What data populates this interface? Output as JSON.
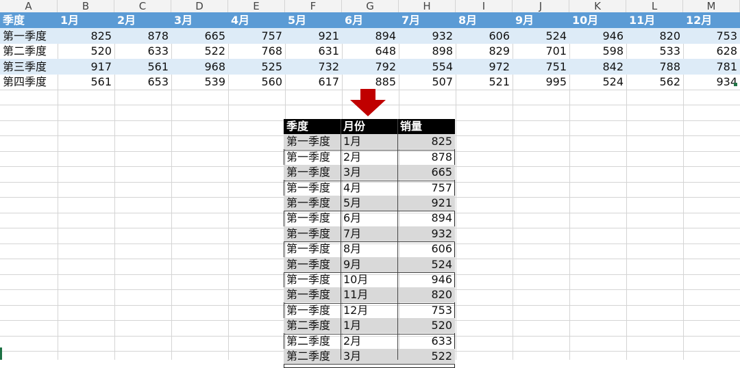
{
  "columns": [
    "A",
    "B",
    "C",
    "D",
    "E",
    "F",
    "G",
    "H",
    "I",
    "J",
    "K",
    "L",
    "M"
  ],
  "source_table": {
    "header": [
      "季度",
      "1月",
      "2月",
      "3月",
      "4月",
      "5月",
      "6月",
      "7月",
      "8月",
      "9月",
      "10月",
      "11月",
      "12月"
    ],
    "rows": [
      {
        "label": "第一季度",
        "values": [
          "825",
          "878",
          "665",
          "757",
          "921",
          "894",
          "932",
          "606",
          "524",
          "946",
          "820",
          "753"
        ]
      },
      {
        "label": "第二季度",
        "values": [
          "520",
          "633",
          "522",
          "768",
          "631",
          "648",
          "898",
          "829",
          "701",
          "598",
          "533",
          "628"
        ]
      },
      {
        "label": "第三季度",
        "values": [
          "917",
          "561",
          "968",
          "525",
          "732",
          "792",
          "554",
          "972",
          "751",
          "842",
          "788",
          "781"
        ]
      },
      {
        "label": "第四季度",
        "values": [
          "561",
          "653",
          "539",
          "560",
          "617",
          "885",
          "507",
          "521",
          "995",
          "524",
          "562",
          "934"
        ]
      }
    ]
  },
  "result_table": {
    "header": [
      "季度",
      "月份",
      "销量"
    ],
    "rows": [
      [
        "第一季度",
        "1月",
        "825"
      ],
      [
        "第一季度",
        "2月",
        "878"
      ],
      [
        "第一季度",
        "3月",
        "665"
      ],
      [
        "第一季度",
        "4月",
        "757"
      ],
      [
        "第一季度",
        "5月",
        "921"
      ],
      [
        "第一季度",
        "6月",
        "894"
      ],
      [
        "第一季度",
        "7月",
        "932"
      ],
      [
        "第一季度",
        "8月",
        "606"
      ],
      [
        "第一季度",
        "9月",
        "524"
      ],
      [
        "第一季度",
        "10月",
        "946"
      ],
      [
        "第一季度",
        "11月",
        "820"
      ],
      [
        "第一季度",
        "12月",
        "753"
      ],
      [
        "第二季度",
        "1月",
        "520"
      ],
      [
        "第二季度",
        "2月",
        "633"
      ],
      [
        "第二季度",
        "3月",
        "522"
      ]
    ]
  },
  "colors": {
    "header_blue": "#5b9bd5",
    "band_blue": "#ddebf7",
    "arrow_red": "#c00000",
    "result_header": "#000000",
    "result_shade": "#d9d9d9"
  },
  "icons": {
    "arrow": "down-arrow-icon"
  }
}
